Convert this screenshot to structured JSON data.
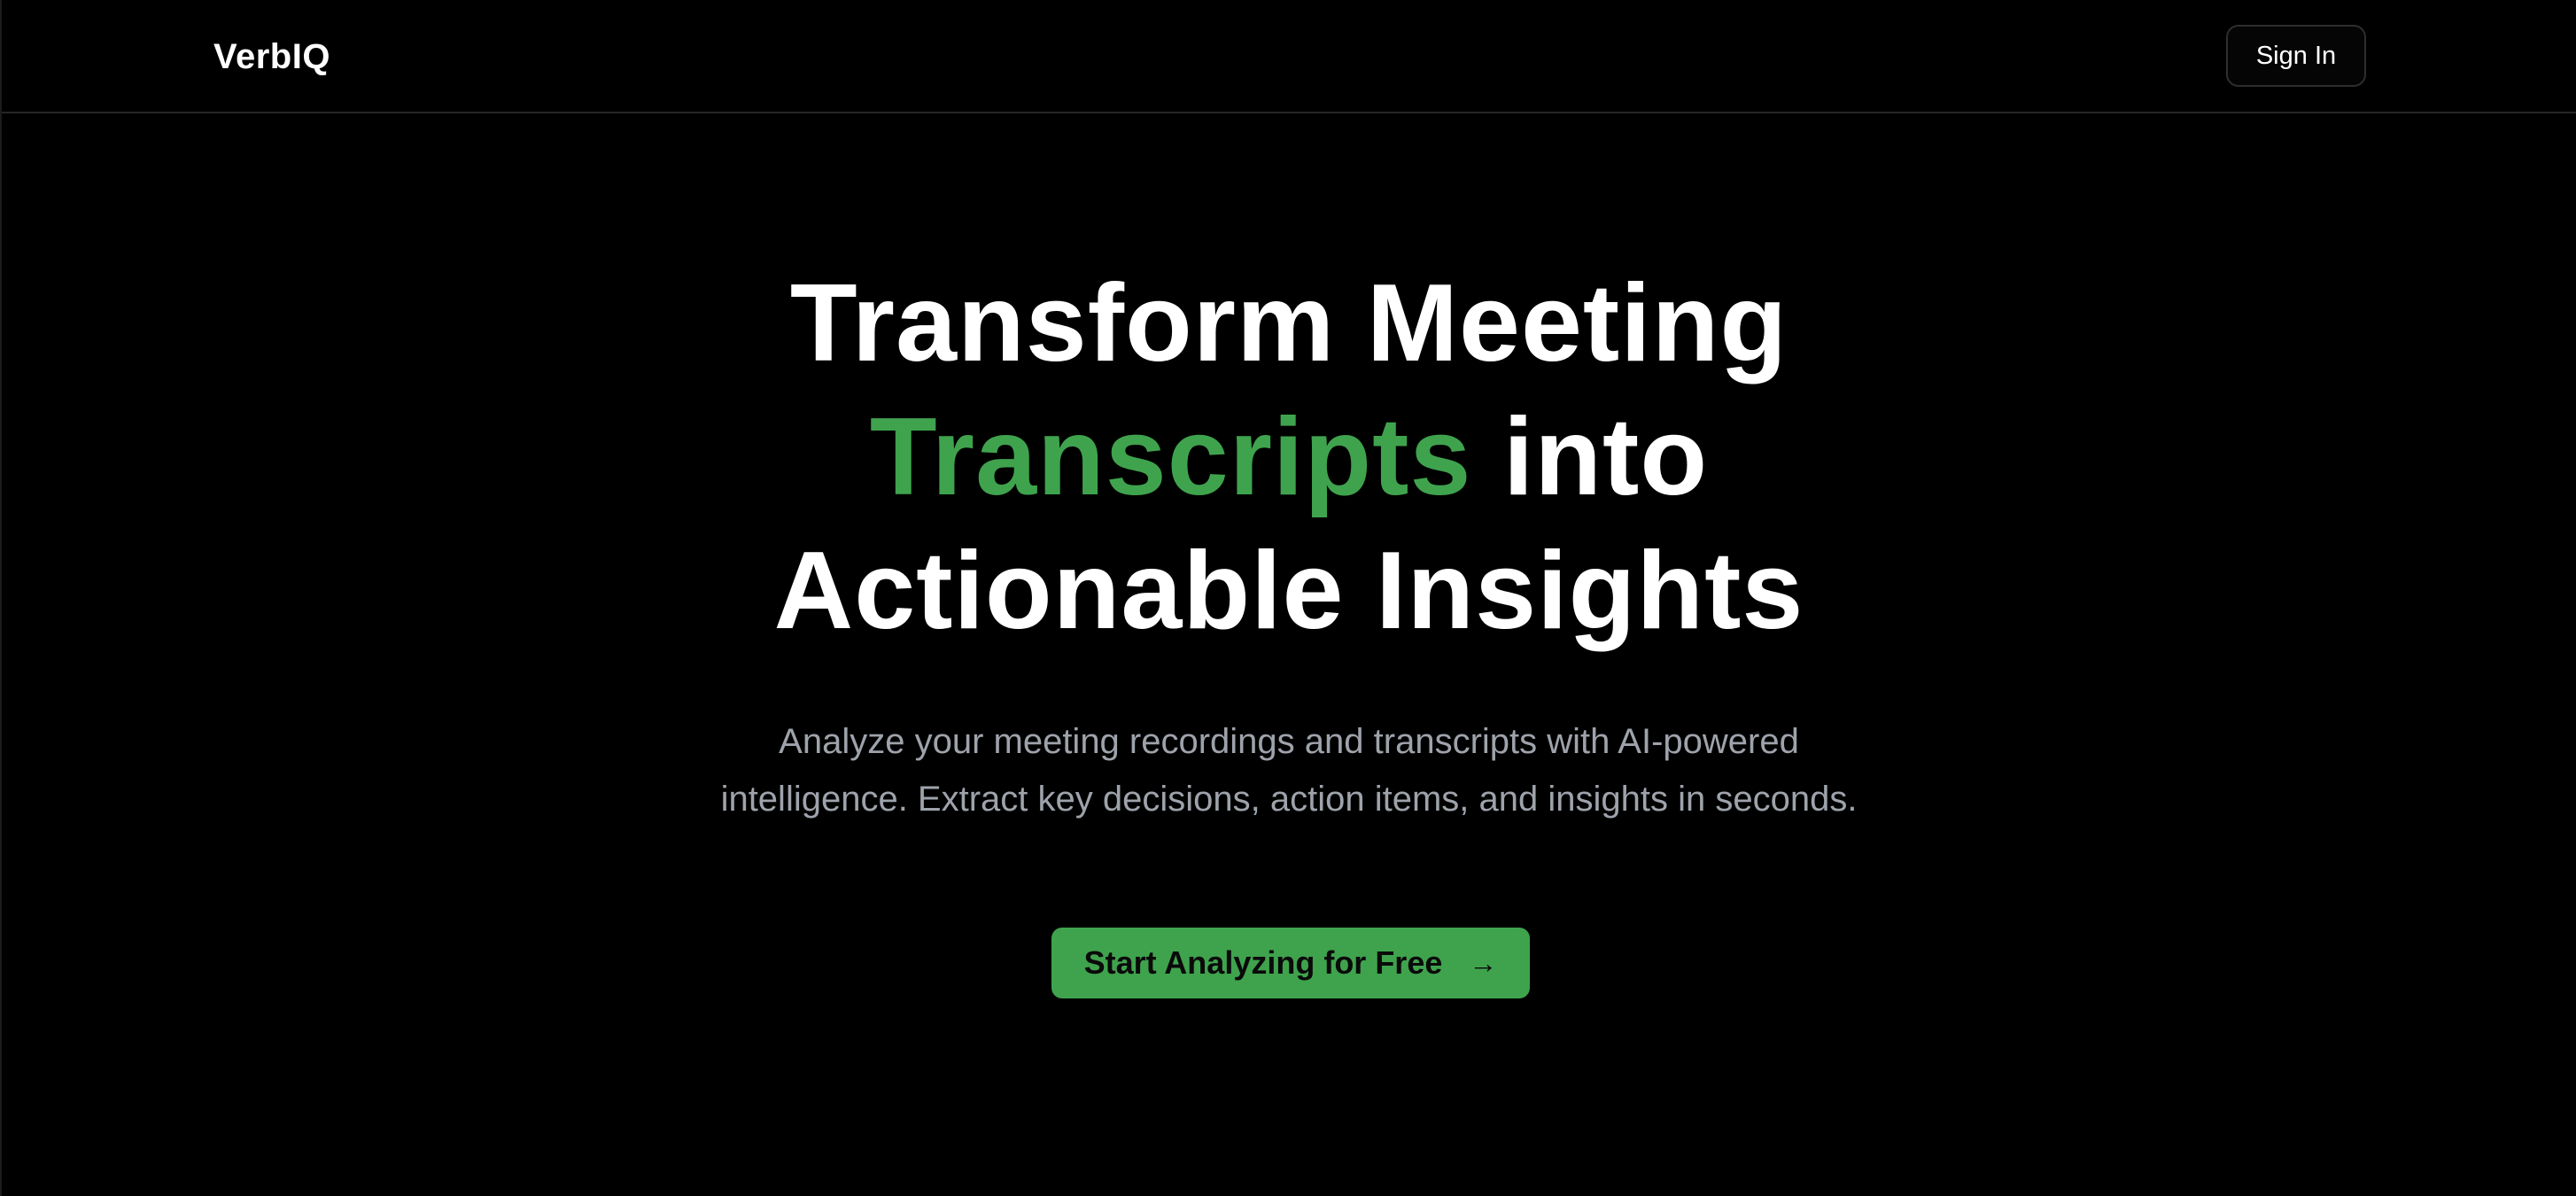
{
  "header": {
    "logo": "VerbIQ",
    "signin_label": "Sign In"
  },
  "hero": {
    "title_line1": "Transform Meeting",
    "title_accent": "Transcripts",
    "title_line2_rest": " into",
    "title_line3": "Actionable Insights",
    "subtitle": "Analyze your meeting recordings and transcripts with AI-powered intelligence. Extract key decisions, action items, and insights in seconds.",
    "cta_label": "Start Analyzing for Free",
    "cta_icon": "→"
  },
  "colors": {
    "background": "#000000",
    "accent": "#3fa34d",
    "subtitle_text": "#9ea3ab"
  },
  "icons": {
    "cta": "arrow-right-icon"
  }
}
